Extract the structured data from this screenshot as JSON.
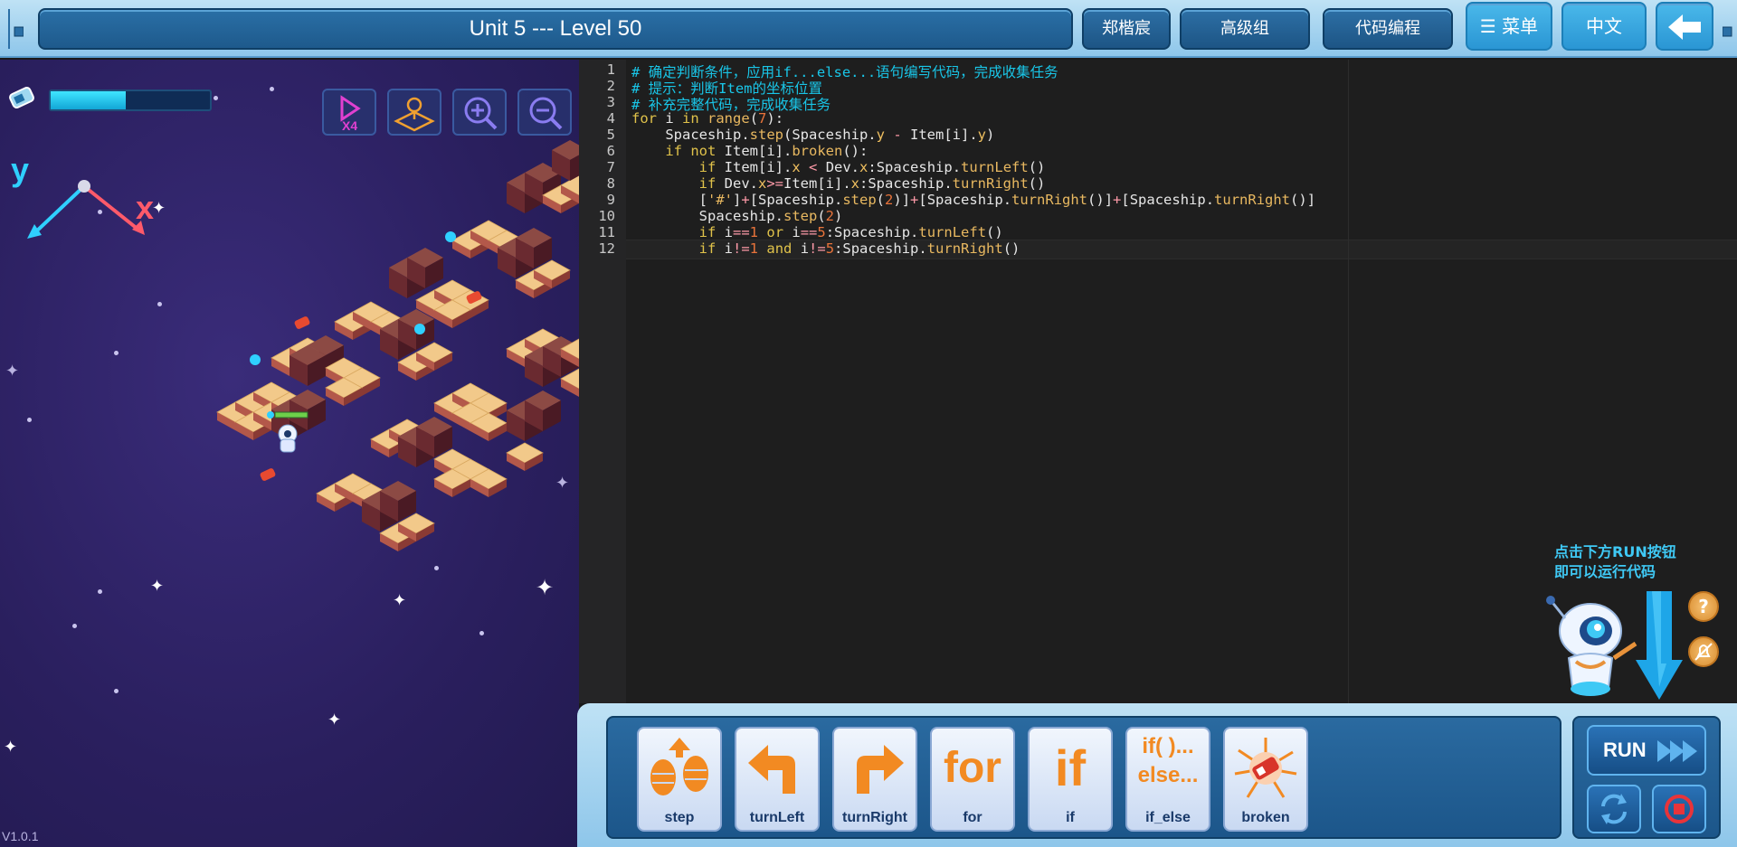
{
  "header": {
    "level_title": "Unit 5 --- Level 50",
    "user_name": "郑楷宸",
    "group": "高级组",
    "mode": "代码编程",
    "menu_label": "菜单",
    "language": "中文"
  },
  "game": {
    "version": "V1.0.1",
    "energy_level": 0.47,
    "axis_y_label": "y",
    "axis_x_label": "x",
    "tools": [
      "speed-x4-icon",
      "map-icon",
      "zoom-in-icon",
      "zoom-out-icon"
    ],
    "speed_label": "X4"
  },
  "editor": {
    "line_numbers": [
      "1",
      "2",
      "3",
      "4",
      "5",
      "6",
      "7",
      "8",
      "9",
      "10",
      "11",
      "12"
    ],
    "lines": [
      "# 确定判断条件，应用if...else...语句编写代码，完成收集任务",
      "# 提示：判断Item的坐标位置",
      "# 补充完整代码，完成收集任务",
      "for i in range(7):",
      "    Spaceship.step(Spaceship.y - Item[i].y)",
      "    if not Item[i].broken():",
      "        if Item[i].x < Dev.x:Spaceship.turnLeft()",
      "        if Dev.x>=Item[i].x:Spaceship.turnRight()",
      "        ['#']+[Spaceship.step(2)]+[Spaceship.turnRight()]+[Spaceship.turnRight()]",
      "        Spaceship.step(2)",
      "        if i==1 or i==5:Spaceship.turnLeft()",
      "        if i!=1 and i!=5:Spaceship.turnRight()"
    ]
  },
  "hint": {
    "line1": "点击下方RUN按钮",
    "line2": "即可以运行代码",
    "help_label": "?"
  },
  "blocks": [
    {
      "label": "step",
      "icon": "step-icon"
    },
    {
      "label": "turnLeft",
      "icon": "turn-left-icon"
    },
    {
      "label": "turnRight",
      "icon": "turn-right-icon"
    },
    {
      "label": "for",
      "icon": "for-icon",
      "text": "for"
    },
    {
      "label": "if",
      "icon": "if-icon",
      "text": "if"
    },
    {
      "label": "if_else",
      "icon": "if-else-icon",
      "text1": "if( )...",
      "text2": "else..."
    },
    {
      "label": "broken",
      "icon": "broken-icon"
    }
  ],
  "run": {
    "run_label": "RUN"
  },
  "colors": {
    "accent": "#2a96d4",
    "comment": "#19c6e8",
    "keyword": "#e0c24a",
    "number": "#e8733a",
    "block_orange": "#f28a22"
  }
}
